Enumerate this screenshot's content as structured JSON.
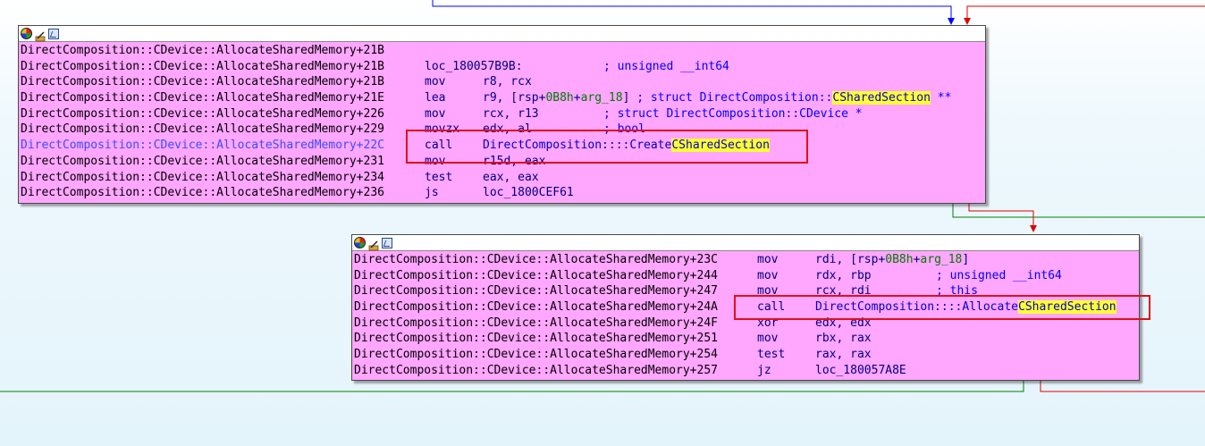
{
  "nodes": [
    {
      "id": "node-1",
      "header_icons": [
        "color-palette-icon",
        "rename-pencil-icon",
        "graph-overview-icon"
      ],
      "lines": [
        {
          "addr": "DirectComposition::CDevice::AllocateSharedMemory+21B",
          "mn": "",
          "ops": ""
        },
        {
          "addr": "DirectComposition::CDevice::AllocateSharedMemory+21B",
          "mn": "loc_180057B9B:",
          "ops": "",
          "comment": "; unsigned __int64"
        },
        {
          "addr": "DirectComposition::CDevice::AllocateSharedMemory+21B",
          "mn": "mov",
          "ops": "r8, rcx"
        },
        {
          "addr": "DirectComposition::CDevice::AllocateSharedMemory+21E",
          "mn": "lea",
          "ops_a": "r9, [rsp+",
          "ops_num": "0B8h",
          "ops_b": "+",
          "ops_var": "arg_18",
          "ops_c": "] ",
          "comment_a": "; struct DirectComposition::",
          "comment_hl": "CSharedSection",
          "comment_b": " **"
        },
        {
          "addr": "DirectComposition::CDevice::AllocateSharedMemory+226",
          "mn": "mov",
          "ops": "rcx, r13",
          "comment": "; struct DirectComposition::CDevice *"
        },
        {
          "addr": "DirectComposition::CDevice::AllocateSharedMemory+229",
          "mn": "movzx",
          "ops": "edx, al",
          "comment": "; bool"
        },
        {
          "addr": "DirectComposition::CDevice::AllocateSharedMemory+22C",
          "mn": "call",
          "ops_a": "DirectComposition::",
          "ops_hl": "CSharedSection",
          "ops_b": "::Create"
        },
        {
          "addr": "DirectComposition::CDevice::AllocateSharedMemory+231",
          "mn": "mov",
          "ops": "r15d, eax"
        },
        {
          "addr": "DirectComposition::CDevice::AllocateSharedMemory+234",
          "mn": "test",
          "ops": "eax, eax"
        },
        {
          "addr": "DirectComposition::CDevice::AllocateSharedMemory+236",
          "mn": "js",
          "ops": "loc_1800CEF61"
        }
      ]
    },
    {
      "id": "node-2",
      "header_icons": [
        "color-palette-icon",
        "rename-pencil-icon",
        "graph-overview-icon"
      ],
      "lines": [
        {
          "addr": "DirectComposition::CDevice::AllocateSharedMemory+23C",
          "mn": "mov",
          "ops_a": "rdi, [rsp+",
          "ops_num": "0B8h",
          "ops_b": "+",
          "ops_var": "arg_18",
          "ops_c": "]"
        },
        {
          "addr": "DirectComposition::CDevice::AllocateSharedMemory+244",
          "mn": "mov",
          "ops": "rdx, rbp",
          "comment": "; unsigned __int64"
        },
        {
          "addr": "DirectComposition::CDevice::AllocateSharedMemory+247",
          "mn": "mov",
          "ops": "rcx, rdi",
          "comment": "; this"
        },
        {
          "addr": "DirectComposition::CDevice::AllocateSharedMemory+24A",
          "mn": "call",
          "ops_a": "DirectComposition::",
          "ops_hl": "CSharedSection",
          "ops_b": "::Allocate"
        },
        {
          "addr": "DirectComposition::CDevice::AllocateSharedMemory+24F",
          "mn": "xor",
          "ops": "edx, edx"
        },
        {
          "addr": "DirectComposition::CDevice::AllocateSharedMemory+251",
          "mn": "mov",
          "ops": "rbx, rax"
        },
        {
          "addr": "DirectComposition::CDevice::AllocateSharedMemory+254",
          "mn": "test",
          "ops": "rax, rax"
        },
        {
          "addr": "DirectComposition::CDevice::AllocateSharedMemory+257",
          "mn": "jz",
          "ops": "loc_180057A8E"
        }
      ]
    }
  ],
  "colors": {
    "node_bg": "#ffa6ff",
    "edge_true": "#008000",
    "edge_false": "#e00000",
    "edge_uncond": "#0000ff",
    "highlight": "#ffff33",
    "annotation_box": "#e0101a"
  }
}
